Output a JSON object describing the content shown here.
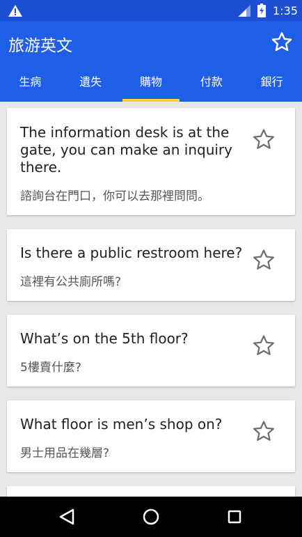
{
  "status_bar": {
    "time": "1:35"
  },
  "app": {
    "title": "旅游英文"
  },
  "tabs": [
    {
      "label": "生病",
      "active": false
    },
    {
      "label": "遺失",
      "active": false
    },
    {
      "label": "購物",
      "active": true
    },
    {
      "label": "付款",
      "active": false
    },
    {
      "label": "銀行",
      "active": false
    }
  ],
  "phrases": [
    {
      "en": "The information desk is at the gate, you can make an inquiry there.",
      "zh": "諮詢台在門口，你可以去那裡問問。",
      "starred": false
    },
    {
      "en": "Is there a public restroom here?",
      "zh": "這裡有公共廁所嗎?",
      "starred": false
    },
    {
      "en": "What’s on the 5th floor?",
      "zh": "5樓賣什麼?",
      "starred": false
    },
    {
      "en": "What floor is men’s shop on?",
      "zh": "男士用品在幾層?",
      "starred": false
    }
  ],
  "colors": {
    "primary": "#1f5fe8",
    "status_bar": "#1c4fd3",
    "tab_indicator": "#f4d03f",
    "background": "#e8e8e8"
  },
  "icons": {
    "warning": "warning-icon",
    "signal": "signal-icon",
    "battery": "battery-icon",
    "favorite": "star-outline-icon",
    "back": "back-icon",
    "home": "home-icon",
    "recents": "recents-icon"
  }
}
